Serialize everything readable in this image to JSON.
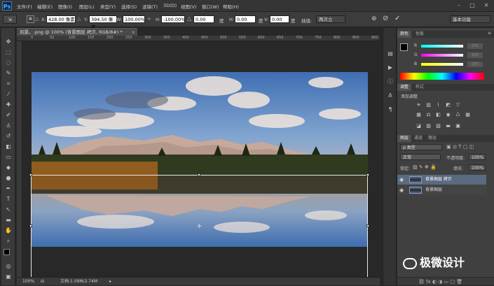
{
  "menubar": {
    "logo": "Ps",
    "items": [
      "文件(F)",
      "编辑(E)",
      "图像(I)",
      "图层(L)",
      "类型(Y)",
      "选择(S)",
      "滤镜(T)",
      "3D(D)",
      "视图(V)",
      "窗口(W)",
      "帮助(H)"
    ],
    "window_buttons": [
      "–",
      "□",
      "✕"
    ]
  },
  "options": {
    "x_label": "X:",
    "x_value": "428.00 像素",
    "y_label": "Y:",
    "y_value": "394.50 像素",
    "w_label": "W:",
    "w_value": "100.00%",
    "h_label": "H:",
    "h_value": "-100.00%",
    "angle_value": "0.00",
    "angle_unit": "度",
    "hskew_label": "H:",
    "hskew_value": "0.00",
    "hskew_unit": "度",
    "vskew_label": "V:",
    "vskew_value": "0.00",
    "vskew_unit": "度",
    "interp_label": "插值:",
    "interp_value": "两次立",
    "workspace": "基本功能"
  },
  "document": {
    "tab_title": "风景。.png @ 100% (背景图层 拷贝, RGB/8#) *",
    "zoom": "100%",
    "doc_info": "文档:1.09M/2.74M",
    "ruler_ticks": [
      "0",
      "50",
      "100",
      "150",
      "200",
      "250",
      "300",
      "350",
      "400",
      "450",
      "500",
      "550",
      "600",
      "650",
      "700",
      "750",
      "800",
      "850",
      "900"
    ]
  },
  "color_panel": {
    "tabs": [
      "颜色",
      "色板"
    ],
    "channels": [
      {
        "label": "R",
        "value": "255"
      },
      {
        "label": "G",
        "value": "255"
      },
      {
        "label": "B",
        "value": "255"
      }
    ]
  },
  "adjust_panel": {
    "tabs": [
      "调整",
      "样式"
    ],
    "title": "添加调整"
  },
  "layers_panel": {
    "tabs": [
      "图层",
      "通道",
      "路径"
    ],
    "filter_kind": "ρ 类型",
    "blend_mode": "正常",
    "opacity_label": "不透明度:",
    "opacity_value": "100%",
    "lock_label": "锁定:",
    "fill_label": "填充:",
    "fill_value": "100%",
    "layers": [
      {
        "name": "背景图层 拷贝",
        "selected": true
      },
      {
        "name": "背景图层",
        "selected": false
      }
    ]
  },
  "watermark": {
    "text": "极微设计"
  },
  "colors": {
    "accent": "#5a6a80",
    "panel": "#404040",
    "canvas_bg": "#282828"
  }
}
